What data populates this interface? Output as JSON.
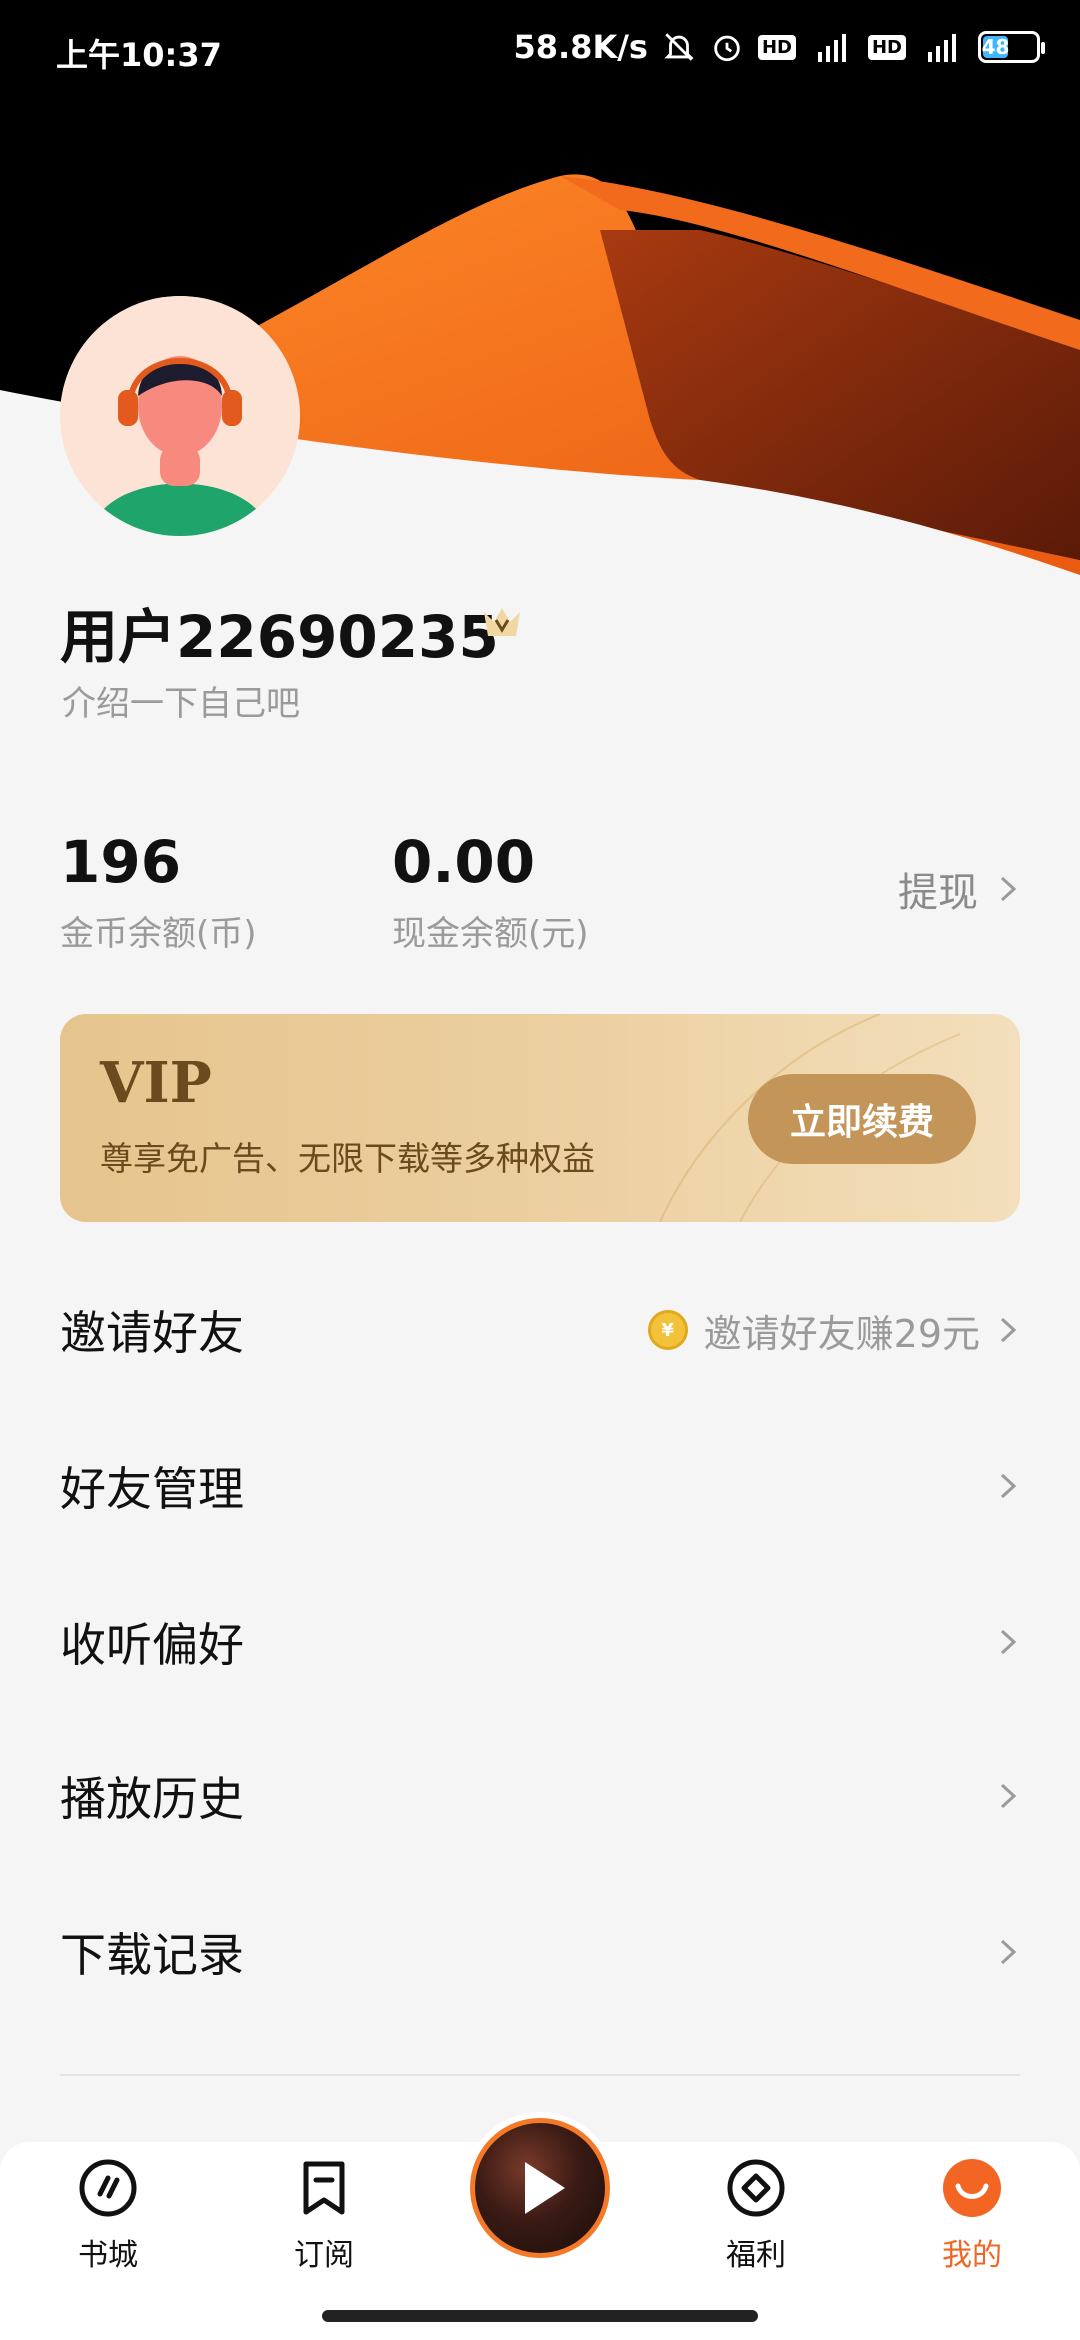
{
  "status_bar": {
    "time": "上午10:37",
    "network_speed": "58.8K/s",
    "icons": [
      "mute-bell-icon",
      "alarm-icon",
      "hd-icon",
      "signal-5g-icon",
      "hd-icon",
      "signal-5g-icon"
    ],
    "hd_label": "HD",
    "battery_level": "48",
    "battery_color": "#3fb6ff"
  },
  "profile": {
    "username": "用户22690235",
    "bio_placeholder": "介绍一下自己吧"
  },
  "stats": {
    "coins_value": "196",
    "coins_label": "金币余额(币)",
    "cash_value": "0.00",
    "cash_label": "现金余额(元)",
    "withdraw_label": "提现"
  },
  "vip": {
    "title": "VIP",
    "description": "尊享免广告、无限下载等多种权益",
    "renew_label": "立即续费"
  },
  "menu": {
    "items": [
      {
        "label": "邀请好友",
        "hint": "邀请好友赚29元"
      },
      {
        "label": "好友管理"
      },
      {
        "label": "收听偏好"
      },
      {
        "label": "播放历史"
      },
      {
        "label": "下载记录"
      }
    ]
  },
  "tabbar": {
    "tabs": [
      {
        "label": "书城",
        "icon": "bookstore-icon"
      },
      {
        "label": "订阅",
        "icon": "bookmark-icon"
      },
      {
        "label": "福利",
        "icon": "welfare-icon"
      },
      {
        "label": "我的",
        "icon": "smile-icon"
      }
    ],
    "active_color": "#f26522"
  },
  "colors": {
    "accent": "#f26522",
    "vip_gold": "#c39559"
  }
}
